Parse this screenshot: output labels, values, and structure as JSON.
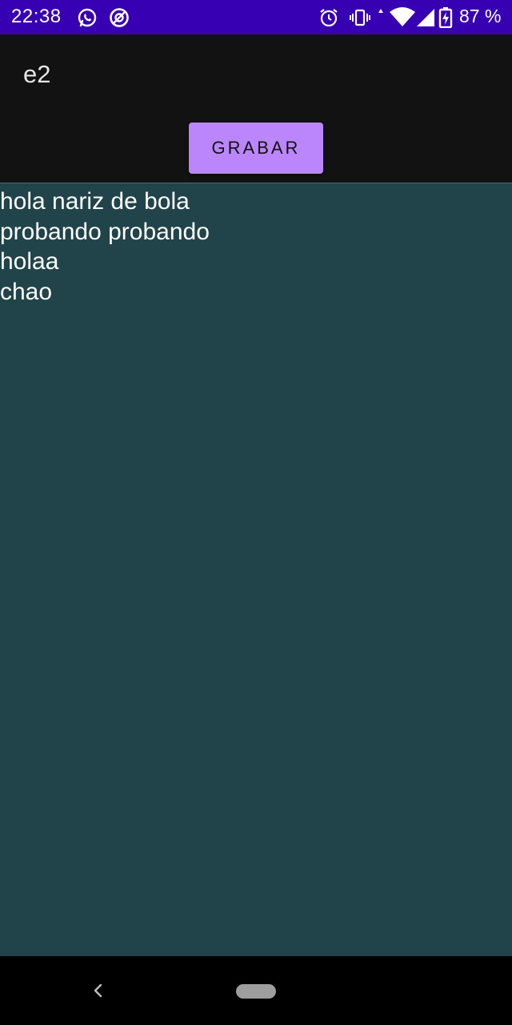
{
  "status_bar": {
    "time": "22:38",
    "battery_percent": "87 %",
    "icons": [
      "whatsapp-icon",
      "circle-slash-icon",
      "alarm-icon",
      "vibrate-icon",
      "data-arrows-icon",
      "wifi-icon",
      "signal-icon",
      "battery-charging-icon"
    ],
    "background": "#3700b3"
  },
  "app_bar": {
    "title": "e2",
    "record_button_label": "GRABAR",
    "accent": "#bb86fc",
    "background": "#121212"
  },
  "content": {
    "background": "#21444a",
    "lines": [
      "hola nariz de bola",
      "probando probando",
      "holaa",
      "chao"
    ]
  },
  "nav_bar": {
    "icons": [
      "back-icon",
      "home-pill-icon"
    ]
  }
}
